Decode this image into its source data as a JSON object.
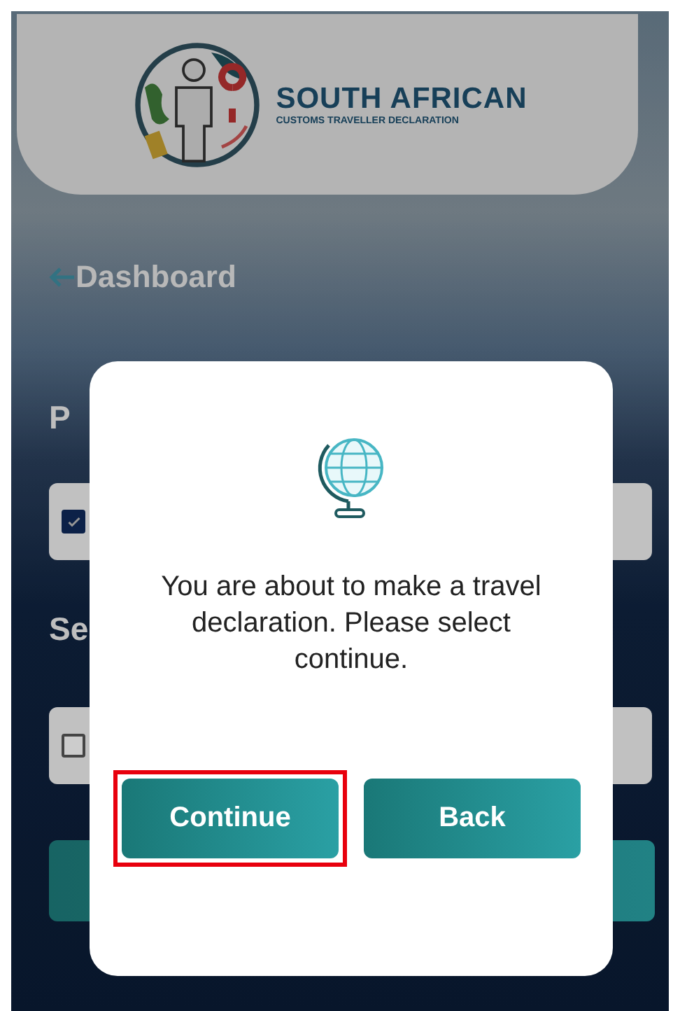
{
  "header": {
    "title": "SOUTH AFRICAN",
    "subtitle": "CUSTOMS TRAVELLER DECLARATION"
  },
  "back_link": {
    "label": "Dashboard"
  },
  "sections": [
    {
      "heading": "P",
      "checked": true
    },
    {
      "heading": "Se",
      "checked": false
    }
  ],
  "dialog": {
    "message": "You are about to make a travel declaration. Please select continue.",
    "buttons": [
      {
        "label": "Continue",
        "highlighted": true
      },
      {
        "label": "Back",
        "highlighted": false
      }
    ]
  }
}
